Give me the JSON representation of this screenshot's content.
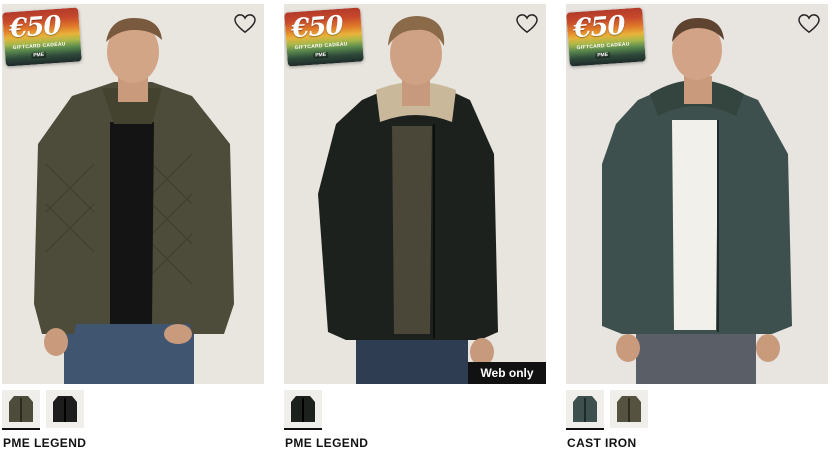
{
  "products": [
    {
      "brand": "PME LEGEND",
      "giftcard": {
        "amount": "€50",
        "label": "GIFTCARD CADEAU",
        "logo": "PME"
      },
      "favorite_icon": "heart-outline-icon",
      "badge": "",
      "colors": {
        "jacket": "#4d4c3a",
        "shirt": "#141414",
        "background": "#e9e5df"
      },
      "swatches": [
        {
          "color": "#4d4c3a"
        },
        {
          "color": "#1c1d1c"
        }
      ]
    },
    {
      "brand": "PME LEGEND",
      "giftcard": {
        "amount": "€50",
        "label": "GIFTCARD CADEAU",
        "logo": "PME"
      },
      "favorite_icon": "heart-outline-icon",
      "badge": "Web only",
      "colors": {
        "jacket": "#1d211e",
        "shirt": "#4a4638",
        "background": "#e8e4de"
      },
      "swatches": [
        {
          "color": "#1d211e"
        }
      ]
    },
    {
      "brand": "CAST IRON",
      "giftcard": {
        "amount": "€50",
        "label": "GIFTCARD CADEAU",
        "logo": "PME"
      },
      "favorite_icon": "heart-outline-icon",
      "badge": "",
      "colors": {
        "jacket": "#3e504e",
        "shirt": "#f2f0ea",
        "background": "#e8e5e0"
      },
      "swatches": [
        {
          "color": "#3e504e"
        },
        {
          "color": "#55523f"
        }
      ]
    }
  ]
}
